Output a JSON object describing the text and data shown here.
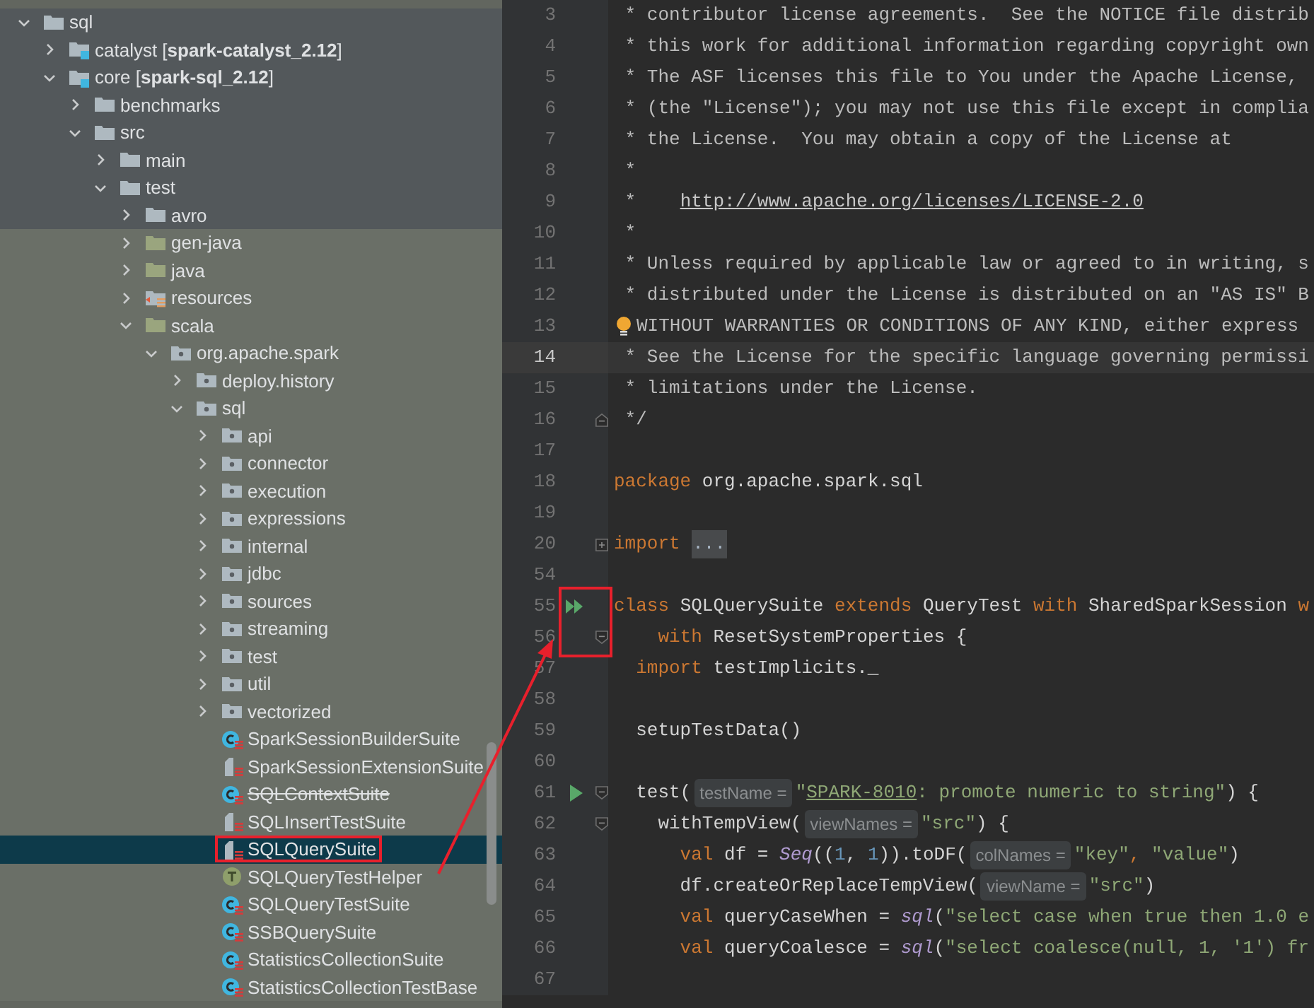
{
  "project_tree": {
    "items": [
      {
        "label": "sql",
        "kind": "folder",
        "expanded": true,
        "children": [
          {
            "label": "catalyst [**spark-catalyst_2.12**]",
            "kind": "module",
            "expanded": false
          },
          {
            "label": "core [**spark-sql_2.12**]",
            "kind": "module",
            "expanded": true,
            "children": [
              {
                "label": "benchmarks",
                "kind": "folder",
                "expanded": false
              },
              {
                "label": "src",
                "kind": "folder",
                "expanded": true,
                "children": [
                  {
                    "label": "main",
                    "kind": "folder",
                    "expanded": false
                  },
                  {
                    "label": "test",
                    "kind": "folder",
                    "expanded": true,
                    "children": [
                      {
                        "label": "avro",
                        "kind": "folder",
                        "expanded": false
                      },
                      {
                        "label": "gen-java",
                        "kind": "test_source_root",
                        "expanded": false
                      },
                      {
                        "label": "java",
                        "kind": "test_source_root",
                        "expanded": false
                      },
                      {
                        "label": "resources",
                        "kind": "test_resource_root",
                        "expanded": false
                      },
                      {
                        "label": "scala",
                        "kind": "test_source_root",
                        "expanded": true,
                        "children": [
                          {
                            "label": "org.apache.spark",
                            "kind": "package",
                            "expanded": true,
                            "children": [
                              {
                                "label": "deploy.history",
                                "kind": "package",
                                "expanded": false
                              },
                              {
                                "label": "sql",
                                "kind": "package",
                                "expanded": true,
                                "children": [
                                  {
                                    "label": "api",
                                    "kind": "package",
                                    "expanded": false
                                  },
                                  {
                                    "label": "connector",
                                    "kind": "package",
                                    "expanded": false
                                  },
                                  {
                                    "label": "execution",
                                    "kind": "package",
                                    "expanded": false
                                  },
                                  {
                                    "label": "expressions",
                                    "kind": "package",
                                    "expanded": false
                                  },
                                  {
                                    "label": "internal",
                                    "kind": "package",
                                    "expanded": false
                                  },
                                  {
                                    "label": "jdbc",
                                    "kind": "package",
                                    "expanded": false
                                  },
                                  {
                                    "label": "sources",
                                    "kind": "package",
                                    "expanded": false
                                  },
                                  {
                                    "label": "streaming",
                                    "kind": "package",
                                    "expanded": false
                                  },
                                  {
                                    "label": "test",
                                    "kind": "package",
                                    "expanded": false
                                  },
                                  {
                                    "label": "util",
                                    "kind": "package",
                                    "expanded": false
                                  },
                                  {
                                    "label": "vectorized",
                                    "kind": "package",
                                    "expanded": false
                                  },
                                  {
                                    "label": "SparkSessionBuilderSuite",
                                    "kind": "test_class",
                                    "selected": false,
                                    "deprecated": false
                                  },
                                  {
                                    "label": "SparkSessionExtensionSuite",
                                    "kind": "test_object",
                                    "selected": false,
                                    "deprecated": false
                                  },
                                  {
                                    "label": "SQLContextSuite",
                                    "kind": "test_class",
                                    "selected": false,
                                    "deprecated": true
                                  },
                                  {
                                    "label": "SQLInsertTestSuite",
                                    "kind": "test_object",
                                    "selected": false,
                                    "deprecated": false
                                  },
                                  {
                                    "label": "SQLQuerySuite",
                                    "kind": "test_object",
                                    "selected": true,
                                    "deprecated": false,
                                    "annotated": true
                                  },
                                  {
                                    "label": "SQLQueryTestHelper",
                                    "kind": "trait",
                                    "selected": false,
                                    "deprecated": false
                                  },
                                  {
                                    "label": "SQLQueryTestSuite",
                                    "kind": "test_class",
                                    "selected": false,
                                    "deprecated": false
                                  },
                                  {
                                    "label": "SSBQuerySuite",
                                    "kind": "test_class",
                                    "selected": false,
                                    "deprecated": false
                                  },
                                  {
                                    "label": "StatisticsCollectionSuite",
                                    "kind": "test_class",
                                    "selected": false,
                                    "deprecated": false
                                  },
                                  {
                                    "label": "StatisticsCollectionTestBase",
                                    "kind": "test_class",
                                    "selected": false,
                                    "deprecated": false
                                  }
                                ]
                              }
                            ]
                          }
                        ]
                      }
                    ]
                  }
                ]
              }
            ]
          }
        ]
      }
    ]
  },
  "editor": {
    "lines": [
      {
        "number": "3",
        "tokens": [
          {
            "kind": "comment",
            "text": " * contributor license agreements.  See the NOTICE file distrib"
          }
        ]
      },
      {
        "number": "4",
        "tokens": [
          {
            "kind": "comment",
            "text": " * this work for additional information regarding copyright own"
          }
        ]
      },
      {
        "number": "5",
        "tokens": [
          {
            "kind": "comment",
            "text": " * The ASF licenses this file to You under the Apache License,"
          }
        ]
      },
      {
        "number": "6",
        "tokens": [
          {
            "kind": "comment",
            "text": " * (the \"License\"); you may not use this file except in complia"
          }
        ]
      },
      {
        "number": "7",
        "tokens": [
          {
            "kind": "comment",
            "text": " * the License.  You may obtain a copy of the License at"
          }
        ]
      },
      {
        "number": "8",
        "tokens": [
          {
            "kind": "comment",
            "text": " *"
          }
        ]
      },
      {
        "number": "9",
        "tokens": [
          {
            "kind": "comment",
            "text": " *    "
          },
          {
            "kind": "link",
            "text": "http://www.apache.org/licenses/LICENSE-2.0"
          }
        ]
      },
      {
        "number": "10",
        "tokens": [
          {
            "kind": "comment",
            "text": " *"
          }
        ]
      },
      {
        "number": "11",
        "tokens": [
          {
            "kind": "comment",
            "text": " * Unless required by applicable law or agreed to in writing, s"
          }
        ]
      },
      {
        "number": "12",
        "tokens": [
          {
            "kind": "comment",
            "text": " * distributed under the License is distributed on an \"AS IS\" B"
          }
        ]
      },
      {
        "number": "13",
        "bulb": true,
        "tokens": [
          {
            "kind": "comment",
            "text": "WITHOUT WARRANTIES OR CONDITIONS OF ANY KIND, either express"
          }
        ]
      },
      {
        "number": "14",
        "current": true,
        "tokens": [
          {
            "kind": "comment",
            "text": " * See the License for the specific language governing permissi"
          }
        ]
      },
      {
        "number": "15",
        "tokens": [
          {
            "kind": "comment",
            "text": " * limitations under the License."
          }
        ]
      },
      {
        "number": "16",
        "fold_end": true,
        "tokens": [
          {
            "kind": "comment",
            "text": " */"
          }
        ]
      },
      {
        "number": "17"
      },
      {
        "number": "18",
        "tokens": [
          {
            "kind": "keyword",
            "text": "package "
          },
          {
            "kind": "plain",
            "text": "org.apache.spark.sql"
          }
        ]
      },
      {
        "number": "19"
      },
      {
        "number": "20",
        "folded": true,
        "tokens": [
          {
            "kind": "keyword",
            "text": "import "
          },
          {
            "kind": "folded",
            "text": "..."
          }
        ]
      },
      {
        "number": "54"
      },
      {
        "number": "55",
        "run_all": true,
        "annotated": true,
        "tokens": [
          {
            "kind": "keyword",
            "text": "class "
          },
          {
            "kind": "plain",
            "text": "SQLQuerySuite "
          },
          {
            "kind": "keyword",
            "text": "extends "
          },
          {
            "kind": "plain",
            "text": "QueryTest "
          },
          {
            "kind": "keyword",
            "text": "with "
          },
          {
            "kind": "plain",
            "text": "SharedSparkSession "
          },
          {
            "kind": "keyword",
            "text": "w"
          }
        ]
      },
      {
        "number": "56",
        "fold_start": true,
        "tokens": [
          {
            "kind": "keyword",
            "text": "    with "
          },
          {
            "kind": "plain",
            "text": "ResetSystemProperties {"
          }
        ]
      },
      {
        "number": "57",
        "tokens": [
          {
            "kind": "keyword",
            "text": "  import "
          },
          {
            "kind": "plain",
            "text": "testImplicits._"
          }
        ]
      },
      {
        "number": "58"
      },
      {
        "number": "59",
        "tokens": [
          {
            "kind": "plain",
            "text": "  setupTestData()"
          }
        ]
      },
      {
        "number": "60"
      },
      {
        "number": "61",
        "run": true,
        "fold_start": true,
        "tokens": [
          {
            "kind": "plain",
            "text": "  test("
          },
          {
            "kind": "hint",
            "text": "testName ="
          },
          {
            "kind": "string",
            "text": "\""
          },
          {
            "kind": "string_link",
            "text": "SPARK-8010"
          },
          {
            "kind": "string",
            "text": ": promote numeric to string\""
          },
          {
            "kind": "plain",
            "text": ") {"
          }
        ]
      },
      {
        "number": "62",
        "fold_start": true,
        "tokens": [
          {
            "kind": "plain",
            "text": "    withTempView("
          },
          {
            "kind": "hint",
            "text": "viewNames ="
          },
          {
            "kind": "string",
            "text": "\"src\""
          },
          {
            "kind": "plain",
            "text": ") {"
          }
        ]
      },
      {
        "number": "63",
        "tokens": [
          {
            "kind": "keyword",
            "text": "      val "
          },
          {
            "kind": "plain",
            "text": "df = "
          },
          {
            "kind": "call",
            "text": "Seq"
          },
          {
            "kind": "plain",
            "text": "(("
          },
          {
            "kind": "number",
            "text": "1"
          },
          {
            "kind": "plain",
            "text": ", "
          },
          {
            "kind": "number",
            "text": "1"
          },
          {
            "kind": "plain",
            "text": ")).toDF("
          },
          {
            "kind": "hint",
            "text": "colNames ="
          },
          {
            "kind": "string",
            "text": "\"key\""
          },
          {
            "kind": "keyword",
            "text": ", "
          },
          {
            "kind": "string",
            "text": "\"value\""
          },
          {
            "kind": "plain",
            "text": ")"
          }
        ]
      },
      {
        "number": "64",
        "tokens": [
          {
            "kind": "plain",
            "text": "      df.createOrReplaceTempView("
          },
          {
            "kind": "hint",
            "text": "viewName ="
          },
          {
            "kind": "string",
            "text": "\"src\""
          },
          {
            "kind": "plain",
            "text": ")"
          }
        ]
      },
      {
        "number": "65",
        "tokens": [
          {
            "kind": "keyword",
            "text": "      val "
          },
          {
            "kind": "plain",
            "text": "queryCaseWhen = "
          },
          {
            "kind": "call",
            "text": "sql"
          },
          {
            "kind": "plain",
            "text": "("
          },
          {
            "kind": "string",
            "text": "\"select case when true then 1.0 e"
          }
        ]
      },
      {
        "number": "66",
        "tokens": [
          {
            "kind": "keyword",
            "text": "      val "
          },
          {
            "kind": "plain",
            "text": "queryCoalesce = "
          },
          {
            "kind": "call",
            "text": "sql"
          },
          {
            "kind": "plain",
            "text": "("
          },
          {
            "kind": "string",
            "text": "\"select coalesce(null, 1, '1') fr"
          }
        ]
      },
      {
        "number": "67"
      }
    ]
  }
}
